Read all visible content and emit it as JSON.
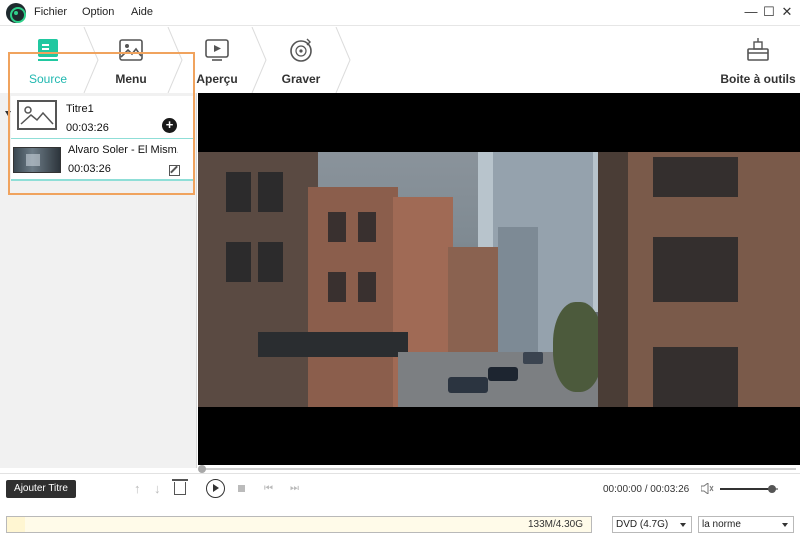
{
  "menu": {
    "items": [
      "Fichier",
      "Option",
      "Aide"
    ]
  },
  "window": {
    "minimize": "—",
    "maximize": "☐",
    "close": "✕"
  },
  "steps": [
    {
      "label": "Source",
      "icon": "source-icon",
      "active": true
    },
    {
      "label": "Menu",
      "icon": "menu-image-icon",
      "active": false
    },
    {
      "label": "Aperçu",
      "icon": "preview-icon",
      "active": false
    },
    {
      "label": "Graver",
      "icon": "burn-disc-icon",
      "active": false
    }
  ],
  "tools": {
    "label": "Boite à outils",
    "icon": "toolbox-icon"
  },
  "source_list": {
    "title": {
      "name": "Titre1",
      "duration": "00:03:26"
    },
    "videos": [
      {
        "name": "Alvaro Soler - El Mism...",
        "duration": "00:03:26"
      }
    ]
  },
  "controls": {
    "add_title_label": "Ajouter Titre",
    "current_time": "00:00:00",
    "total_time": "00:03:26",
    "volume": 0.9,
    "seek_position": 0.0
  },
  "status": {
    "capacity_text": "133M/4.30G",
    "capacity_fraction": 0.03,
    "disc_type": "DVD (4.7G)",
    "quality": "la norme"
  },
  "colors": {
    "accent": "#20b8b0",
    "highlight": "#f0a35e"
  }
}
